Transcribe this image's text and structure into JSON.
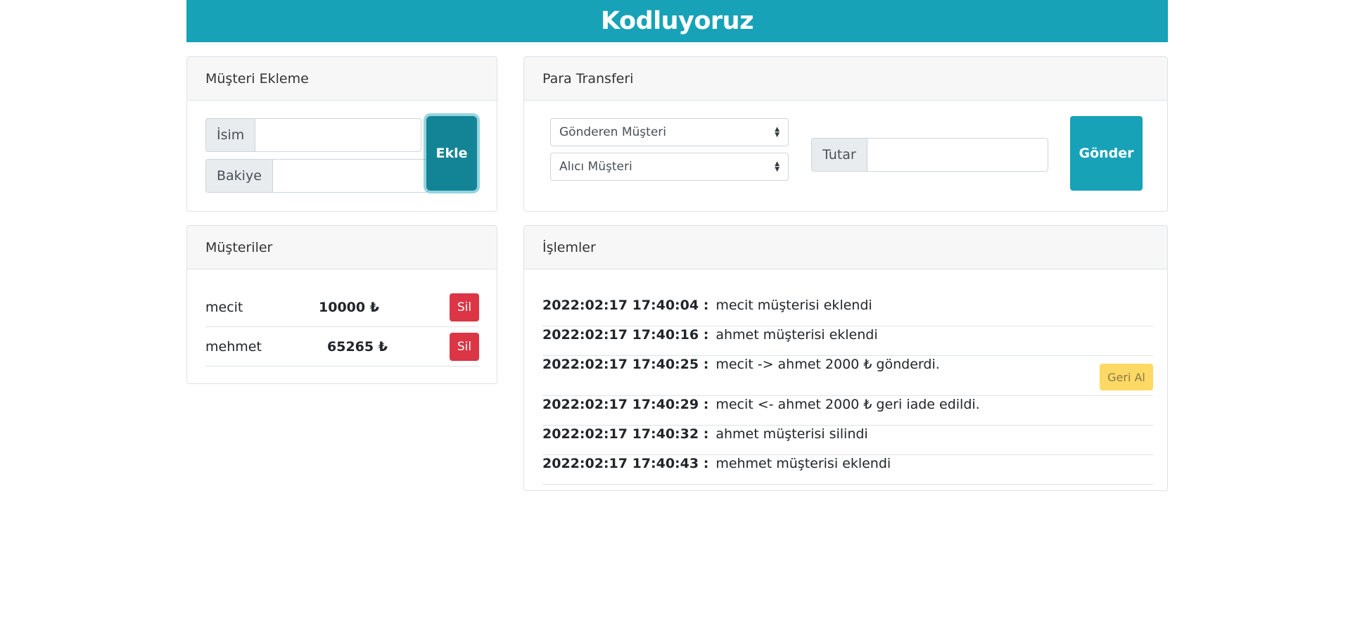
{
  "header": {
    "title": "Kodluyoruz"
  },
  "add_customer": {
    "title": "Müşteri Ekleme",
    "name_label": "İsim",
    "balance_label": "Bakiye",
    "add_button": "Ekle"
  },
  "transfer": {
    "title": "Para Transferi",
    "sender_select": "Gönderen Müşteri",
    "receiver_select": "Alıcı Müşteri",
    "amount_label": "Tutar",
    "send_button": "Gönder"
  },
  "customers": {
    "title": "Müşteriler",
    "items": [
      {
        "name": "mecit",
        "balance": "10000 ₺",
        "delete": "Sil"
      },
      {
        "name": "mehmet",
        "balance": "65265 ₺",
        "delete": "Sil"
      }
    ]
  },
  "transactions": {
    "title": "İşlemler",
    "undo_label": "Geri Al",
    "items": [
      {
        "time": "2022:02:17 17:40:04 :",
        "text": "mecit müşterisi eklendi"
      },
      {
        "time": "2022:02:17 17:40:16 :",
        "text": "ahmet müşterisi eklendi"
      },
      {
        "time": "2022:02:17 17:40:25 :",
        "text": "mecit -> ahmet 2000 ₺ gönderdi."
      },
      {
        "time": "2022:02:17 17:40:29 :",
        "text": "mecit <- ahmet 2000 ₺ geri iade edildi."
      },
      {
        "time": "2022:02:17 17:40:32 :",
        "text": "ahmet müşterisi silindi"
      },
      {
        "time": "2022:02:17 17:40:43 :",
        "text": "mehmet müşterisi eklendi"
      }
    ]
  },
  "colors": {
    "header": "#17a2b8",
    "add_button": "#138496",
    "send_button": "#17a2b8",
    "delete_button": "#dc3545",
    "undo_button": "#ffd966"
  }
}
